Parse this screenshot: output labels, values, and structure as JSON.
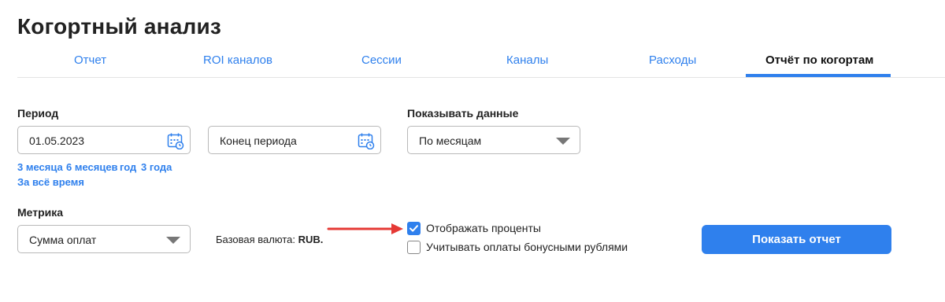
{
  "page": {
    "title": "Когортный анализ"
  },
  "tabs": [
    {
      "label": "Отчет",
      "active": false
    },
    {
      "label": "ROI каналов",
      "active": false
    },
    {
      "label": "Сессии",
      "active": false
    },
    {
      "label": "Каналы",
      "active": false
    },
    {
      "label": "Расходы",
      "active": false
    },
    {
      "label": "Отчёт по когортам",
      "active": true
    }
  ],
  "period": {
    "label": "Период",
    "start_value": "01.05.2023",
    "end_placeholder": "Конец периода",
    "quick_links": [
      "3 месяца",
      "6 месяцев",
      "год",
      "3 года",
      "За всё время"
    ]
  },
  "show_data": {
    "label": "Показывать данные",
    "selected": "По месяцам"
  },
  "metric": {
    "label": "Метрика",
    "selected": "Сумма оплат"
  },
  "currency": {
    "prefix": "Базовая валюта:",
    "value": "RUB."
  },
  "options": {
    "show_percent": {
      "label": "Отображать проценты",
      "checked": true
    },
    "bonus_payments": {
      "label": "Учитывать оплаты бонусными рублями",
      "checked": false
    }
  },
  "submit_button": {
    "label": "Показать отчет"
  },
  "colors": {
    "accent": "#2f80ed",
    "annotation_arrow": "#e53935"
  }
}
